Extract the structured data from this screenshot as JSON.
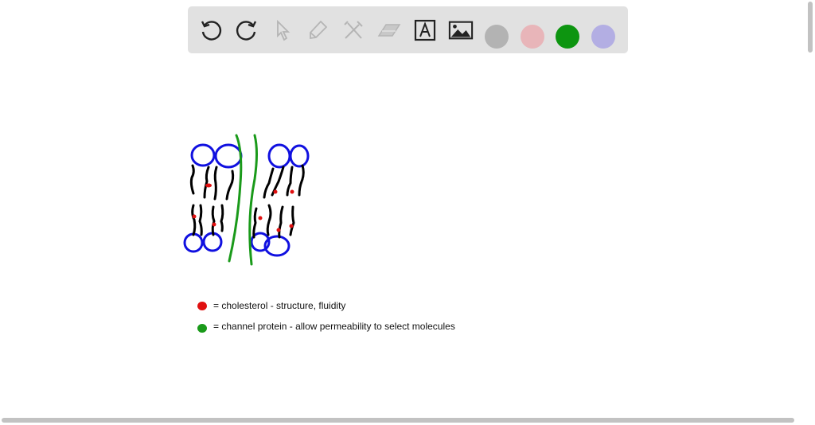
{
  "toolbar": {
    "tools": [
      "undo-icon",
      "redo-icon",
      "select-pointer-icon",
      "pen-icon",
      "tools-icon",
      "eraser-icon",
      "text-icon",
      "image-icon"
    ],
    "colors": {
      "gray": "#b3b3b3",
      "pink": "#e8b5b9",
      "green": "#0d9510",
      "lavender": "#b3aee3"
    }
  },
  "drawing": {
    "colors": {
      "head": "#1010e0",
      "tail": "#000000",
      "cholesterol": "#e01010",
      "protein": "#1a9a1a"
    }
  },
  "legend": [
    {
      "label": "= cholesterol - structure, fluidity",
      "color": "#e01010"
    },
    {
      "label": "= channel protein - allow permeability to select molecules",
      "color": "#1a9a1a"
    }
  ]
}
